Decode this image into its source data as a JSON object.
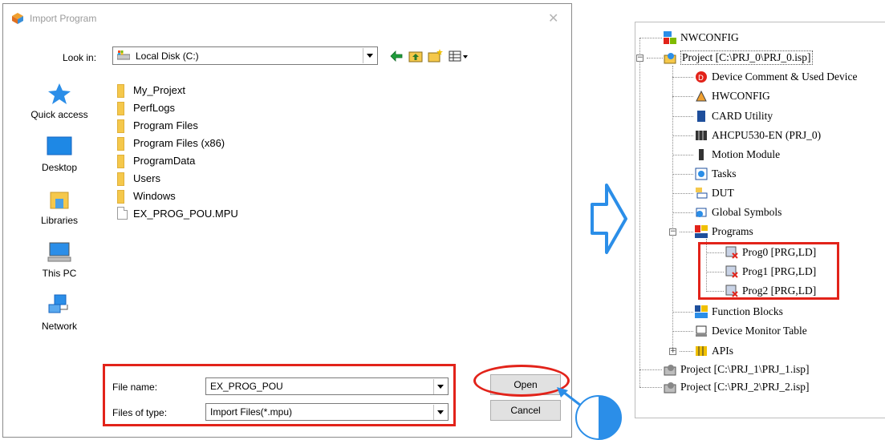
{
  "dialog": {
    "title": "Import Program",
    "look_in_label": "Look in:",
    "look_in_value": "Local Disk (C:)",
    "places": [
      {
        "label": "Quick access",
        "icon": "quick-access-star-icon"
      },
      {
        "label": "Desktop",
        "icon": "desktop-icon"
      },
      {
        "label": "Libraries",
        "icon": "libraries-icon"
      },
      {
        "label": "This PC",
        "icon": "this-pc-icon"
      },
      {
        "label": "Network",
        "icon": "network-icon"
      }
    ],
    "files": [
      {
        "name": "My_Projext",
        "type": "folder"
      },
      {
        "name": "PerfLogs",
        "type": "folder"
      },
      {
        "name": "Program Files",
        "type": "folder"
      },
      {
        "name": "Program Files (x86)",
        "type": "folder"
      },
      {
        "name": "ProgramData",
        "type": "folder"
      },
      {
        "name": "Users",
        "type": "folder"
      },
      {
        "name": "Windows",
        "type": "folder"
      },
      {
        "name": "EX_PROG_POU.MPU",
        "type": "file"
      }
    ],
    "file_name_label": "File name:",
    "file_name_value": "EX_PROG_POU",
    "file_type_label": "Files of type:",
    "file_type_value": "Import Files(*.mpu)",
    "open_label": "Open",
    "cancel_label": "Cancel"
  },
  "tree": {
    "items": [
      {
        "label": "NWCONFIG",
        "icon": "nwconfig-icon"
      },
      {
        "label": "Project [C:\\PRJ_0\\PRJ_0.isp]",
        "icon": "project-icon"
      },
      {
        "label": "Device Comment & Used Device",
        "icon": "device-comment-icon"
      },
      {
        "label": "HWCONFIG",
        "icon": "hwconfig-icon"
      },
      {
        "label": "CARD Utility",
        "icon": "card-utility-icon"
      },
      {
        "label": "AHCPU530-EN  (PRJ_0)",
        "icon": "cpu-icon"
      },
      {
        "label": "Motion Module",
        "icon": "motion-module-icon"
      },
      {
        "label": "Tasks",
        "icon": "tasks-icon"
      },
      {
        "label": "DUT",
        "icon": "dut-icon"
      },
      {
        "label": "Global Symbols",
        "icon": "global-symbols-icon"
      },
      {
        "label": "Programs",
        "icon": "programs-icon"
      },
      {
        "label": "Prog0 [PRG,LD]",
        "icon": "program-item-icon"
      },
      {
        "label": "Prog1 [PRG,LD]",
        "icon": "program-item-icon"
      },
      {
        "label": "Prog2 [PRG,LD]",
        "icon": "program-item-icon"
      },
      {
        "label": "Function Blocks",
        "icon": "function-blocks-icon"
      },
      {
        "label": "Device Monitor Table",
        "icon": "device-monitor-icon"
      },
      {
        "label": "APIs",
        "icon": "apis-icon"
      },
      {
        "label": "Project [C:\\PRJ_1\\PRJ_1.isp]",
        "icon": "project-icon"
      },
      {
        "label": "Project [C:\\PRJ_2\\PRJ_2.isp]",
        "icon": "project-icon"
      }
    ]
  },
  "colors": {
    "highlight_red": "#e2231a",
    "arrow_blue": "#2b8ee8"
  }
}
